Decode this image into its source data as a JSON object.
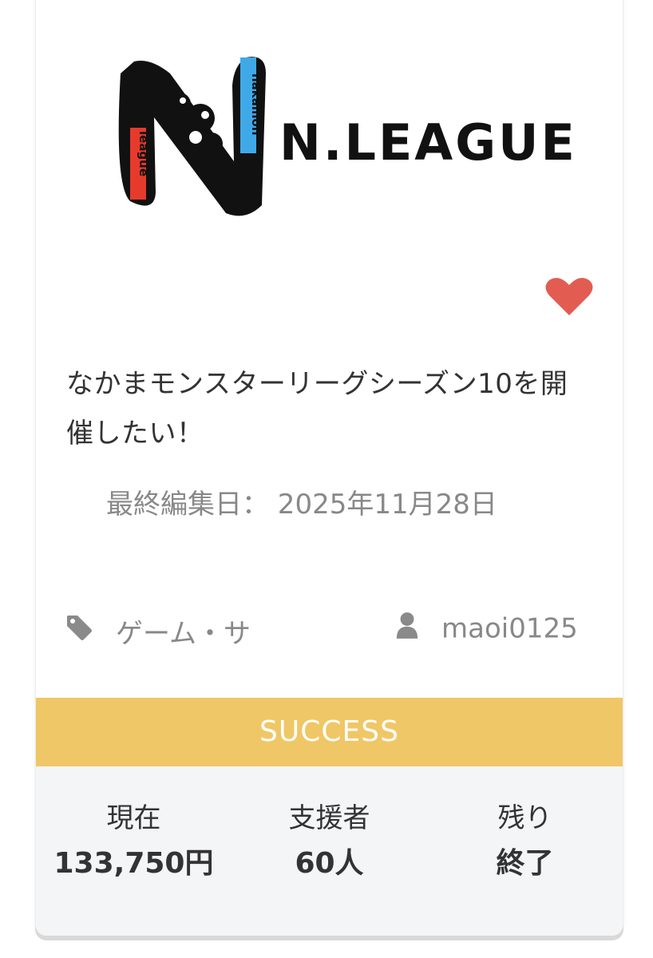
{
  "project": {
    "logo_text": "N.LEAGUE",
    "logo_mark_words": [
      "nakamon",
      "league"
    ],
    "title": "なかまモンスターリーグシーズン10を開催したい！",
    "edited": "最終編集日： 2025年11月28日",
    "category": "ゲーム・サ",
    "user": "maoi0125",
    "status": "SUCCESS"
  },
  "stats": {
    "current_label": "現在",
    "current_value": "133,750円",
    "backers_label": "支援者",
    "backers_value": "60人",
    "remaining_label": "残り",
    "remaining_value": "終了"
  },
  "colors": {
    "status_bg": "#f0c766",
    "heart": "#e25c52",
    "stats_bg": "#f4f5f7",
    "logo_blue": "#3fa9e8",
    "logo_red": "#e63a2c"
  },
  "icons": {
    "favorite": "heart-icon",
    "category": "tag-icon",
    "user": "user-icon"
  }
}
